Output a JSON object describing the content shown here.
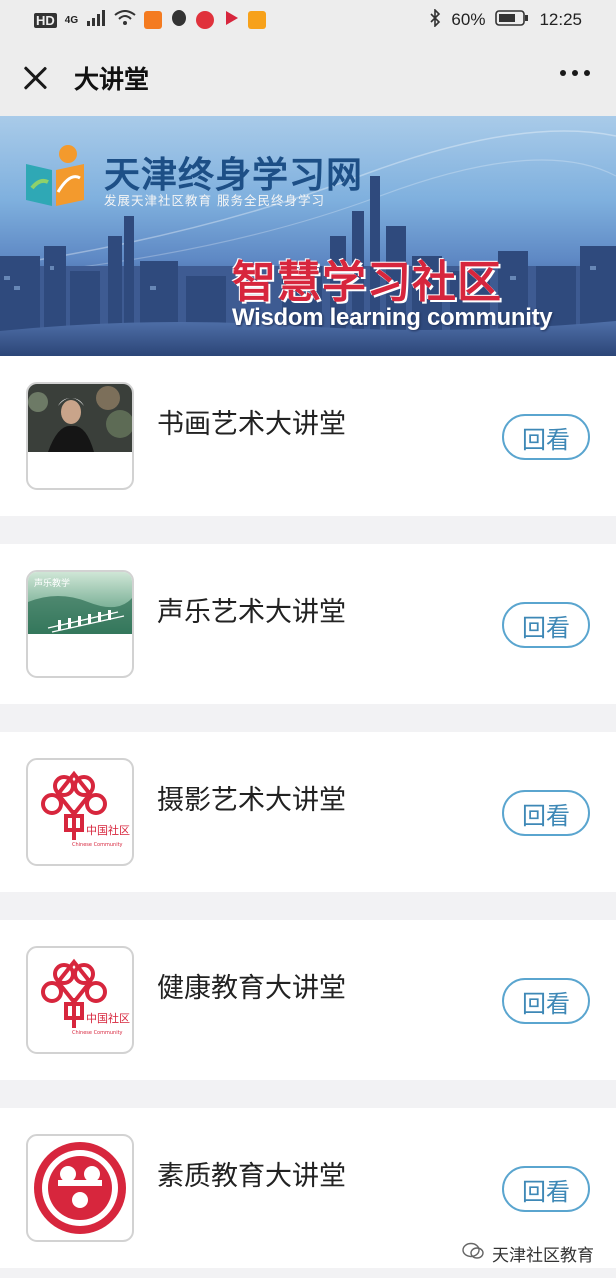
{
  "status_bar": {
    "left_badges": [
      "HD",
      "4G"
    ],
    "battery": "60%",
    "time": "12:25"
  },
  "nav": {
    "title": "大讲堂"
  },
  "banner": {
    "site_name": "天津终身学习网",
    "site_tagline": "发展天津社区教育  服务全民终身学习",
    "slogan": "智慧学习社区",
    "slogan_en": "Wisdom learning community"
  },
  "lectures": [
    {
      "title": "书画艺术大讲堂",
      "button": "回看",
      "thumb": "photo-portrait"
    },
    {
      "title": "声乐艺术大讲堂",
      "button": "回看",
      "thumb": "vocal-music"
    },
    {
      "title": "摄影艺术大讲堂",
      "button": "回看",
      "thumb": "china-community-logo"
    },
    {
      "title": "健康教育大讲堂",
      "button": "回看",
      "thumb": "china-community-logo"
    },
    {
      "title": "素质教育大讲堂",
      "button": "回看",
      "thumb": "women-federation-logo"
    }
  ],
  "thumb_texts": {
    "vocal_label": "声乐教学",
    "community_cn": "中国社区",
    "community_en": "Chinese Community"
  },
  "watermark": "天津社区教育",
  "colors": {
    "accent": "#5aa5cf",
    "logo_red": "#d7263d"
  }
}
